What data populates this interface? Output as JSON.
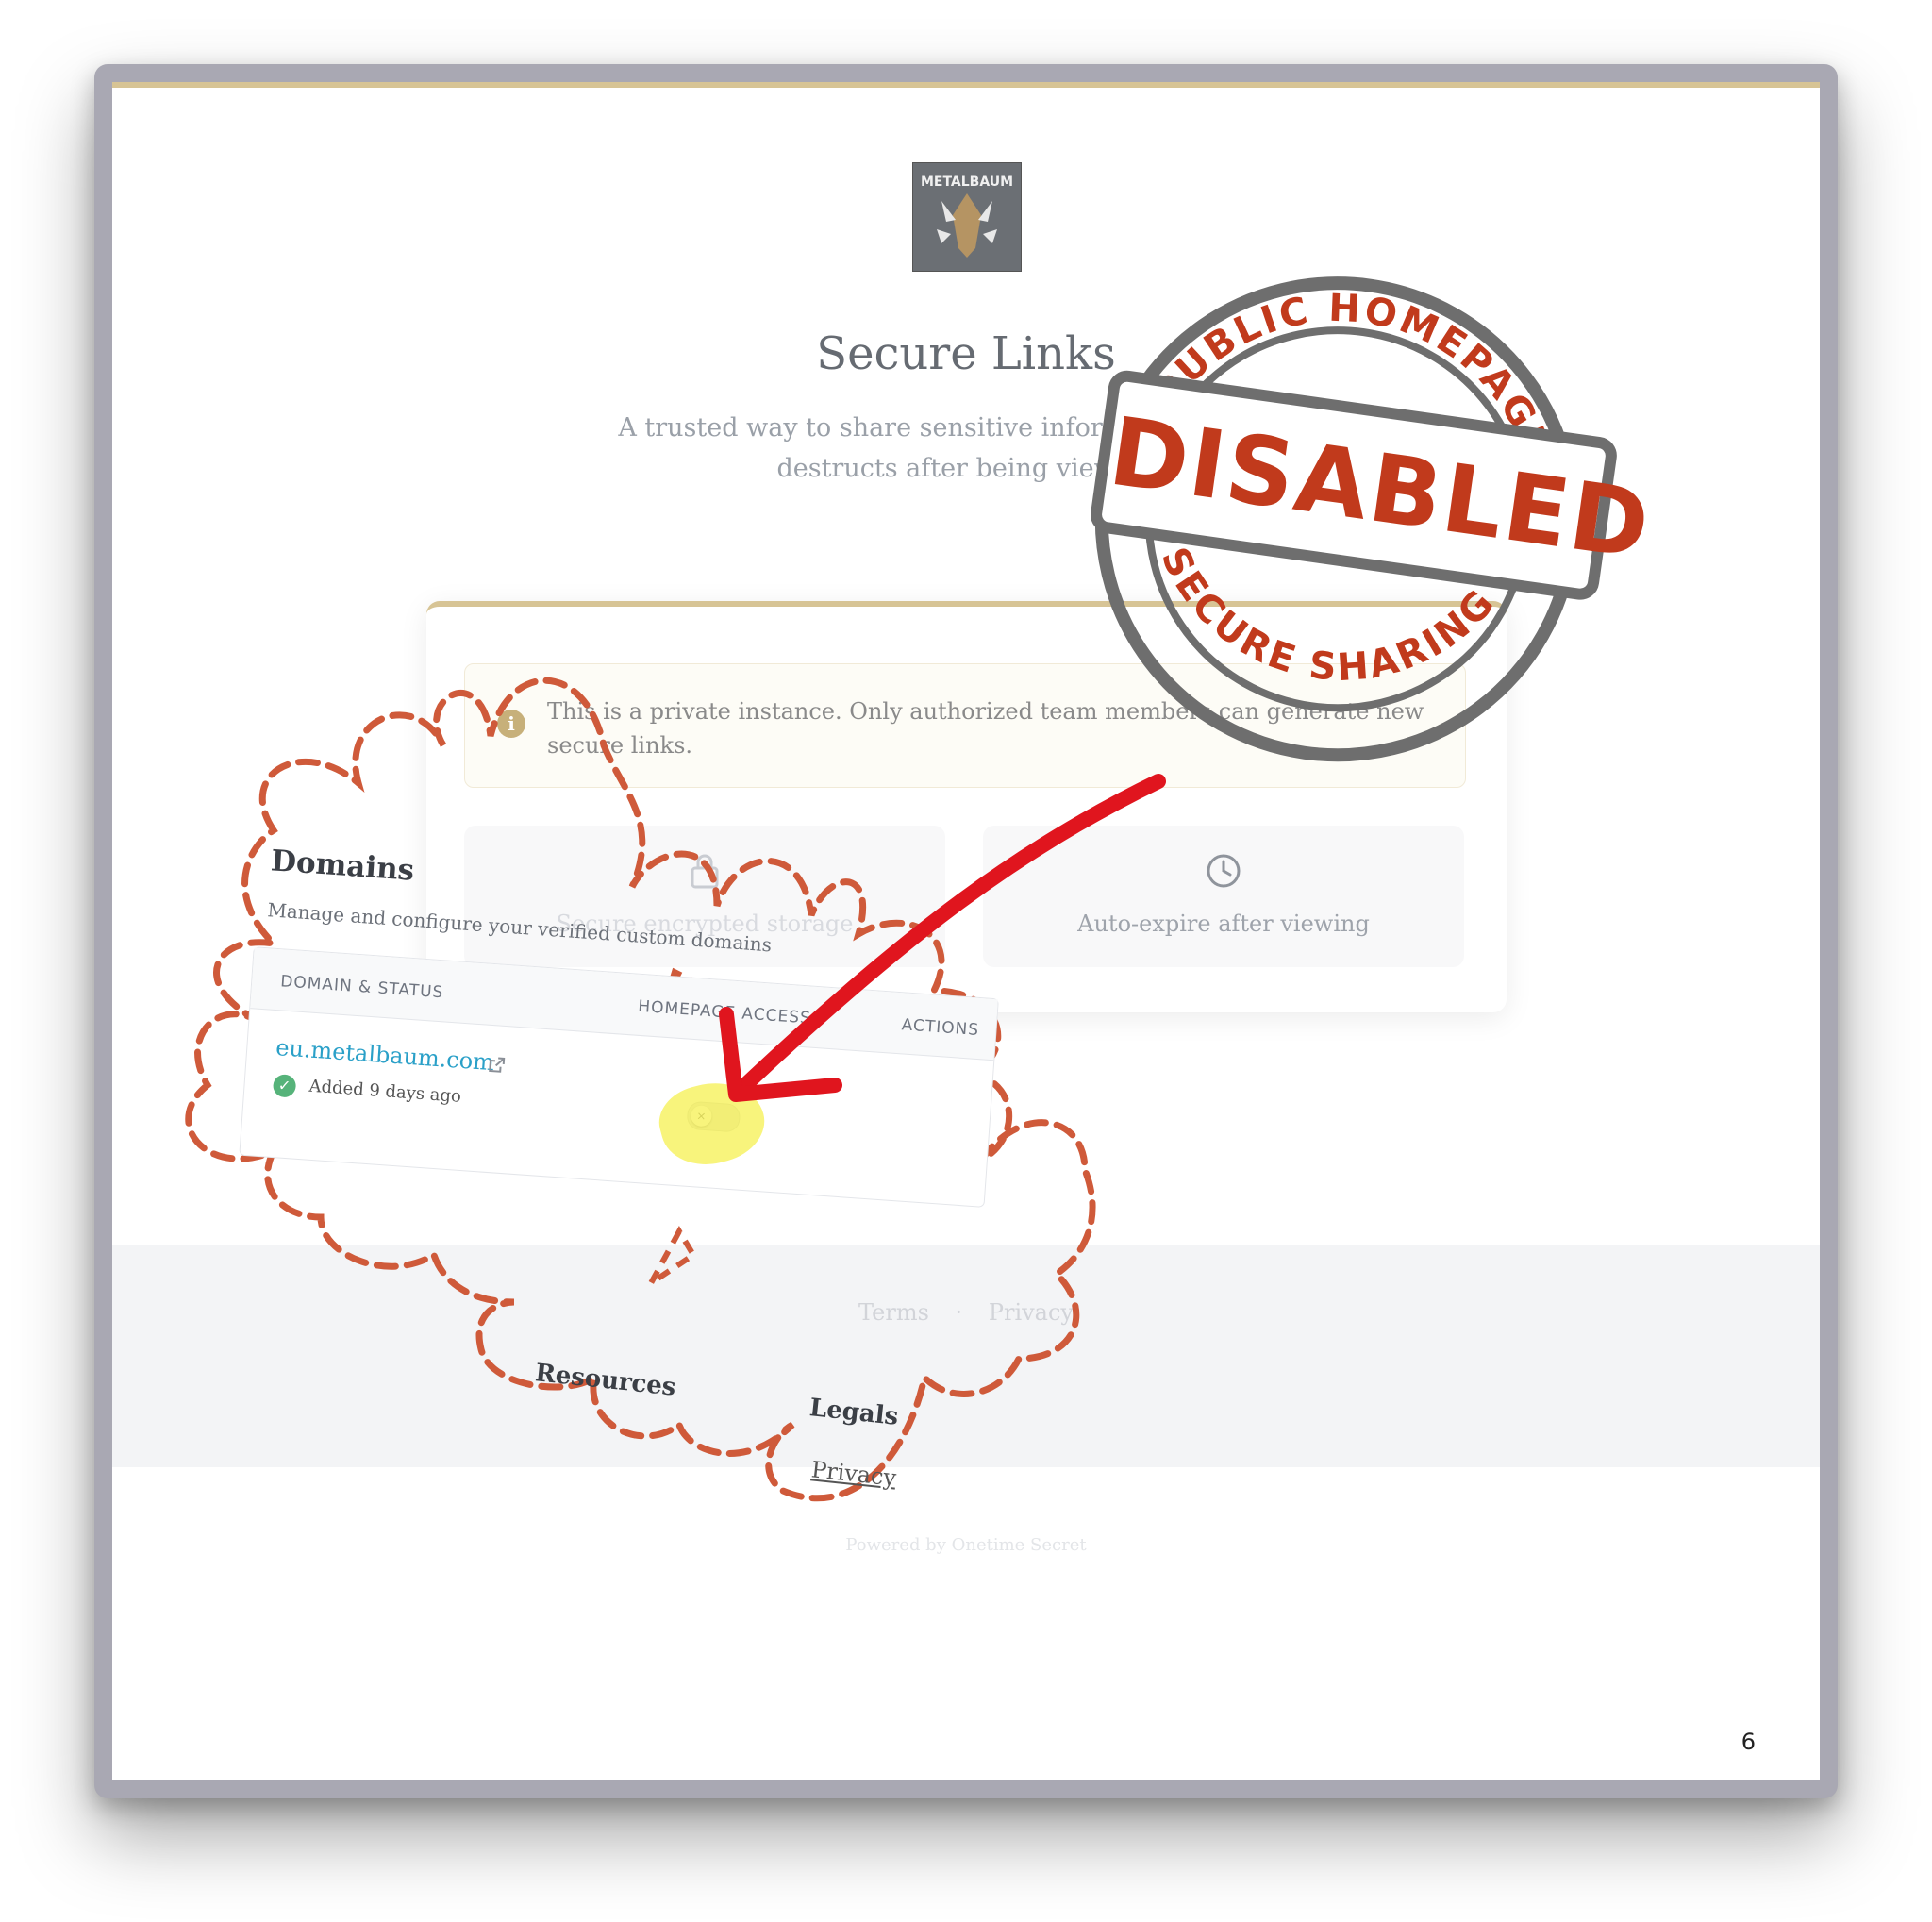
{
  "page": {
    "brand_logo_text": "METALBAUM",
    "title": "Secure Links",
    "subtitle": "A trusted way to share sensitive information that self-destructs after being viewed.",
    "notice": {
      "icon": "info-icon",
      "text": "This is a private instance. Only authorized team members can generate new secure links."
    },
    "features": [
      {
        "icon": "lock-icon",
        "label": "Secure encrypted storage"
      },
      {
        "icon": "clock-icon",
        "label": "Auto-expire after viewing"
      }
    ],
    "footer": {
      "links": [
        "Terms",
        "·",
        "Privacy"
      ],
      "powered_by": "Powered by Onetime Secret"
    },
    "page_number": "6"
  },
  "domains_panel": {
    "title": "Domains",
    "subtitle": "Manage and configure your verified custom domains",
    "columns": [
      "DOMAIN & STATUS",
      "HOMEPAGE ACCESS",
      "ACTIONS"
    ],
    "rows": [
      {
        "domain": "eu.metalbaum.com",
        "status_icon": "check-circle-icon",
        "added": "Added 9 days ago",
        "homepage_access": false
      }
    ]
  },
  "overlay_fragments": {
    "resources_heading": "Resources",
    "legals_heading": "Legals",
    "privacy_link": "Privacy"
  },
  "stamp": {
    "top_text": "PUBLIC HOMEPAGE",
    "main_text": "DISABLED",
    "bottom_text": "SECURE SHARING",
    "color": "#c13a1c"
  },
  "colors": {
    "accent_gold": "#d7c495",
    "link_blue": "#2aa0c8",
    "arrow_red": "#e0151e",
    "cloud_outline": "#cf5a3a",
    "highlight_yellow": "#f6f050"
  }
}
